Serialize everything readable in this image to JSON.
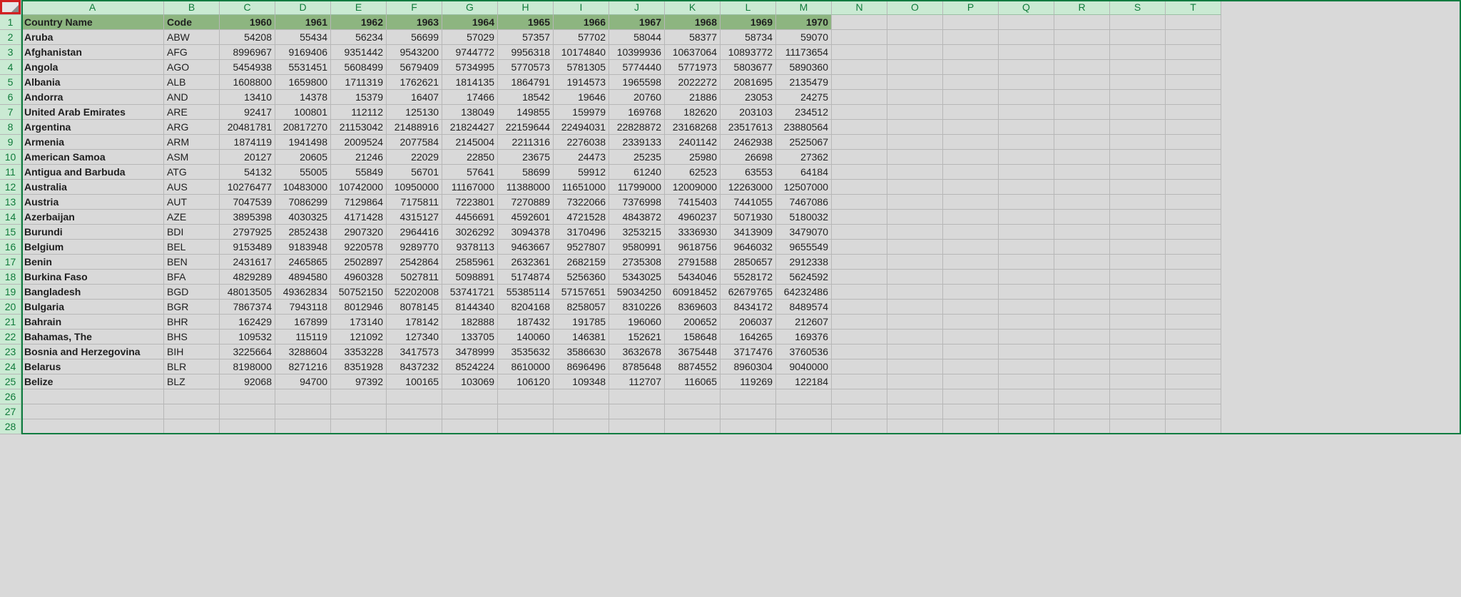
{
  "corner_highlight": true,
  "columns": [
    "A",
    "B",
    "C",
    "D",
    "E",
    "F",
    "G",
    "H",
    "I",
    "J",
    "K",
    "L",
    "M",
    "N",
    "O",
    "P",
    "Q",
    "R",
    "S",
    "T"
  ],
  "header_row": [
    "Country Name",
    "Code",
    "1960",
    "1961",
    "1962",
    "1963",
    "1964",
    "1965",
    "1966",
    "1967",
    "1968",
    "1969",
    "1970"
  ],
  "row_numbers": [
    1,
    2,
    3,
    4,
    5,
    6,
    7,
    8,
    9,
    10,
    11,
    12,
    13,
    14,
    15,
    16,
    17,
    18,
    19,
    20,
    21,
    22,
    23,
    24,
    25,
    26,
    27,
    28
  ],
  "empty_cols_after": 7,
  "chart_data": {
    "type": "table",
    "title": "",
    "columns": [
      "Country Name",
      "Code",
      "1960",
      "1961",
      "1962",
      "1963",
      "1964",
      "1965",
      "1966",
      "1967",
      "1968",
      "1969",
      "1970"
    ],
    "rows": [
      {
        "country": "Aruba",
        "code": "ABW",
        "values": [
          54208,
          55434,
          56234,
          56699,
          57029,
          57357,
          57702,
          58044,
          58377,
          58734,
          59070
        ]
      },
      {
        "country": "Afghanistan",
        "code": "AFG",
        "values": [
          8996967,
          9169406,
          9351442,
          9543200,
          9744772,
          9956318,
          10174840,
          10399936,
          10637064,
          10893772,
          11173654
        ]
      },
      {
        "country": "Angola",
        "code": "AGO",
        "values": [
          5454938,
          5531451,
          5608499,
          5679409,
          5734995,
          5770573,
          5781305,
          5774440,
          5771973,
          5803677,
          5890360
        ]
      },
      {
        "country": "Albania",
        "code": "ALB",
        "values": [
          1608800,
          1659800,
          1711319,
          1762621,
          1814135,
          1864791,
          1914573,
          1965598,
          2022272,
          2081695,
          2135479
        ]
      },
      {
        "country": "Andorra",
        "code": "AND",
        "values": [
          13410,
          14378,
          15379,
          16407,
          17466,
          18542,
          19646,
          20760,
          21886,
          23053,
          24275
        ]
      },
      {
        "country": "United Arab Emirates",
        "code": "ARE",
        "values": [
          92417,
          100801,
          112112,
          125130,
          138049,
          149855,
          159979,
          169768,
          182620,
          203103,
          234512
        ]
      },
      {
        "country": "Argentina",
        "code": "ARG",
        "values": [
          20481781,
          20817270,
          21153042,
          21488916,
          21824427,
          22159644,
          22494031,
          22828872,
          23168268,
          23517613,
          23880564
        ]
      },
      {
        "country": "Armenia",
        "code": "ARM",
        "values": [
          1874119,
          1941498,
          2009524,
          2077584,
          2145004,
          2211316,
          2276038,
          2339133,
          2401142,
          2462938,
          2525067
        ]
      },
      {
        "country": "American Samoa",
        "code": "ASM",
        "values": [
          20127,
          20605,
          21246,
          22029,
          22850,
          23675,
          24473,
          25235,
          25980,
          26698,
          27362
        ]
      },
      {
        "country": "Antigua and Barbuda",
        "code": "ATG",
        "values": [
          54132,
          55005,
          55849,
          56701,
          57641,
          58699,
          59912,
          61240,
          62523,
          63553,
          64184
        ]
      },
      {
        "country": "Australia",
        "code": "AUS",
        "values": [
          10276477,
          10483000,
          10742000,
          10950000,
          11167000,
          11388000,
          11651000,
          11799000,
          12009000,
          12263000,
          12507000
        ]
      },
      {
        "country": "Austria",
        "code": "AUT",
        "values": [
          7047539,
          7086299,
          7129864,
          7175811,
          7223801,
          7270889,
          7322066,
          7376998,
          7415403,
          7441055,
          7467086
        ]
      },
      {
        "country": "Azerbaijan",
        "code": "AZE",
        "values": [
          3895398,
          4030325,
          4171428,
          4315127,
          4456691,
          4592601,
          4721528,
          4843872,
          4960237,
          5071930,
          5180032
        ]
      },
      {
        "country": "Burundi",
        "code": "BDI",
        "values": [
          2797925,
          2852438,
          2907320,
          2964416,
          3026292,
          3094378,
          3170496,
          3253215,
          3336930,
          3413909,
          3479070
        ]
      },
      {
        "country": "Belgium",
        "code": "BEL",
        "values": [
          9153489,
          9183948,
          9220578,
          9289770,
          9378113,
          9463667,
          9527807,
          9580991,
          9618756,
          9646032,
          9655549
        ]
      },
      {
        "country": "Benin",
        "code": "BEN",
        "values": [
          2431617,
          2465865,
          2502897,
          2542864,
          2585961,
          2632361,
          2682159,
          2735308,
          2791588,
          2850657,
          2912338
        ]
      },
      {
        "country": "Burkina Faso",
        "code": "BFA",
        "values": [
          4829289,
          4894580,
          4960328,
          5027811,
          5098891,
          5174874,
          5256360,
          5343025,
          5434046,
          5528172,
          5624592
        ]
      },
      {
        "country": "Bangladesh",
        "code": "BGD",
        "values": [
          48013505,
          49362834,
          50752150,
          52202008,
          53741721,
          55385114,
          57157651,
          59034250,
          60918452,
          62679765,
          64232486
        ]
      },
      {
        "country": "Bulgaria",
        "code": "BGR",
        "values": [
          7867374,
          7943118,
          8012946,
          8078145,
          8144340,
          8204168,
          8258057,
          8310226,
          8369603,
          8434172,
          8489574
        ]
      },
      {
        "country": "Bahrain",
        "code": "BHR",
        "values": [
          162429,
          167899,
          173140,
          178142,
          182888,
          187432,
          191785,
          196060,
          200652,
          206037,
          212607
        ]
      },
      {
        "country": "Bahamas, The",
        "code": "BHS",
        "values": [
          109532,
          115119,
          121092,
          127340,
          133705,
          140060,
          146381,
          152621,
          158648,
          164265,
          169376
        ]
      },
      {
        "country": "Bosnia and Herzegovina",
        "code": "BIH",
        "values": [
          3225664,
          3288604,
          3353228,
          3417573,
          3478999,
          3535632,
          3586630,
          3632678,
          3675448,
          3717476,
          3760536
        ]
      },
      {
        "country": "Belarus",
        "code": "BLR",
        "values": [
          8198000,
          8271216,
          8351928,
          8437232,
          8524224,
          8610000,
          8696496,
          8785648,
          8874552,
          8960304,
          9040000
        ]
      },
      {
        "country": "Belize",
        "code": "BLZ",
        "values": [
          92068,
          94700,
          97392,
          100165,
          103069,
          106120,
          109348,
          112707,
          116065,
          119269,
          122184
        ]
      }
    ]
  }
}
